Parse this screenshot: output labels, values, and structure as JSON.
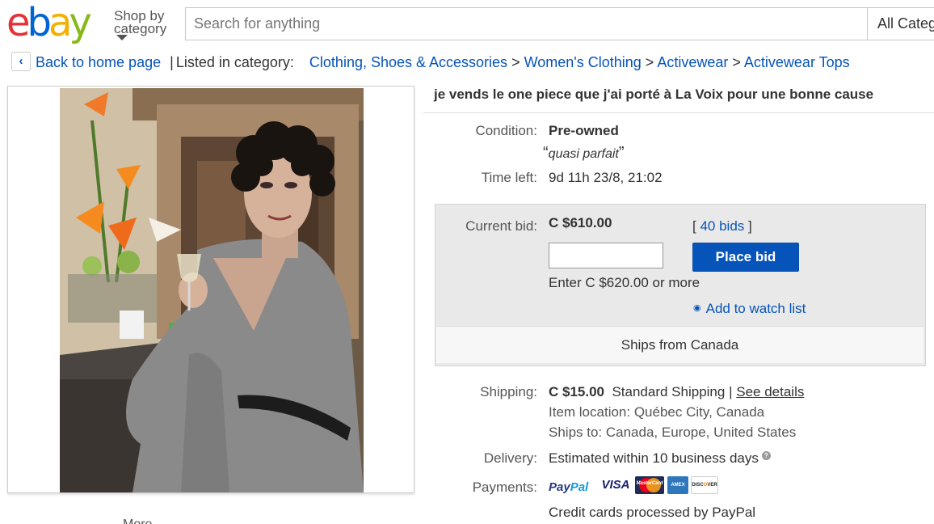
{
  "header": {
    "logo_letters": [
      "e",
      "b",
      "a",
      "y"
    ],
    "shop_by": "Shop by",
    "category": "category",
    "search_placeholder": "Search for anything",
    "category_select": "All Categories"
  },
  "breadcrumb": {
    "back_label": "Back to home page",
    "separator": "|",
    "listed_in": "Listed in category:",
    "gt": ">",
    "categories": [
      "Clothing, Shoes & Accessories",
      "Women's Clothing",
      "Activewear",
      "Activewear Tops"
    ]
  },
  "listing": {
    "title": "je vends le one piece que j'ai porté à La Voix pour une bonne cause",
    "condition_label": "Condition:",
    "condition_value": "Pre-owned",
    "condition_note": "quasi parfait",
    "quote_open": "“",
    "quote_close": "”",
    "time_left_label": "Time left:",
    "time_left_value": "9d 11h 23/8, 21:02"
  },
  "bid": {
    "current_bid_label": "Current bid:",
    "current_bid_value": "C $610.00",
    "bids_open": "[",
    "bids_count": "40 bids",
    "bids_close": "]",
    "input_value": "",
    "place_bid_label": "Place bid",
    "enter_hint": "Enter C $620.00 or more",
    "watch_label": "Add to watch list",
    "ships_from": "Ships from Canada"
  },
  "shipping": {
    "shipping_label": "Shipping:",
    "shipping_cost": "C $15.00",
    "shipping_method": "Standard Shipping",
    "separator": "|",
    "see_details": "See details",
    "item_location": "Item location: Québec City, Canada",
    "ships_to": "Ships to: Canada, Europe, United States",
    "delivery_label": "Delivery:",
    "delivery_value": "Estimated within 10 business days",
    "help_glyph": "?",
    "payments_label": "Payments:",
    "paypal_part1": "Pay",
    "paypal_part2": "Pal",
    "visa": "VISA",
    "mastercard": "MasterCard",
    "amex": "AMEX",
    "discover_a": "DISC",
    "discover_o": "O",
    "discover_b": "VER",
    "credit_note": "Credit cards processed by PayPal"
  },
  "below_image": "More"
}
